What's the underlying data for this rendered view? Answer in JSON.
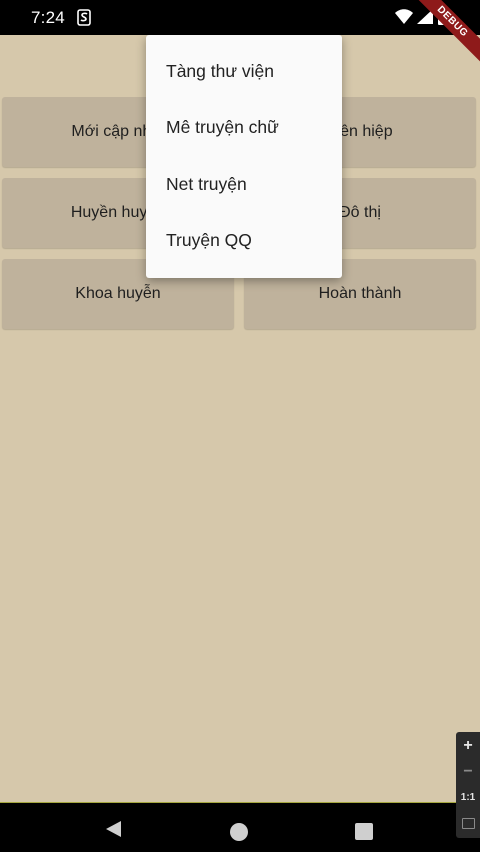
{
  "status_bar": {
    "time": "7:24",
    "icons": [
      "s-app-icon",
      "wifi-icon",
      "signal-icon",
      "battery-icon"
    ]
  },
  "debug_banner": {
    "label": "DEBUG"
  },
  "categories": [
    "Mới cập nhật",
    "Tiên hiệp",
    "Huyền huyễn",
    "Đô thị",
    "Khoa huyễn",
    "Hoàn thành"
  ],
  "popup_menu": {
    "items": [
      "Tàng thư viện",
      "Mê truyện chữ",
      "Net truyện",
      "Truyện QQ"
    ]
  },
  "zoom_controls": {
    "zoom_in": "+",
    "zoom_out": "−",
    "ratio": "1:1"
  },
  "colors": {
    "background": "#d6c8ab",
    "tile": "#bfb29c",
    "menu": "#fafafa",
    "debug_ribbon": "#8e1a1a"
  }
}
